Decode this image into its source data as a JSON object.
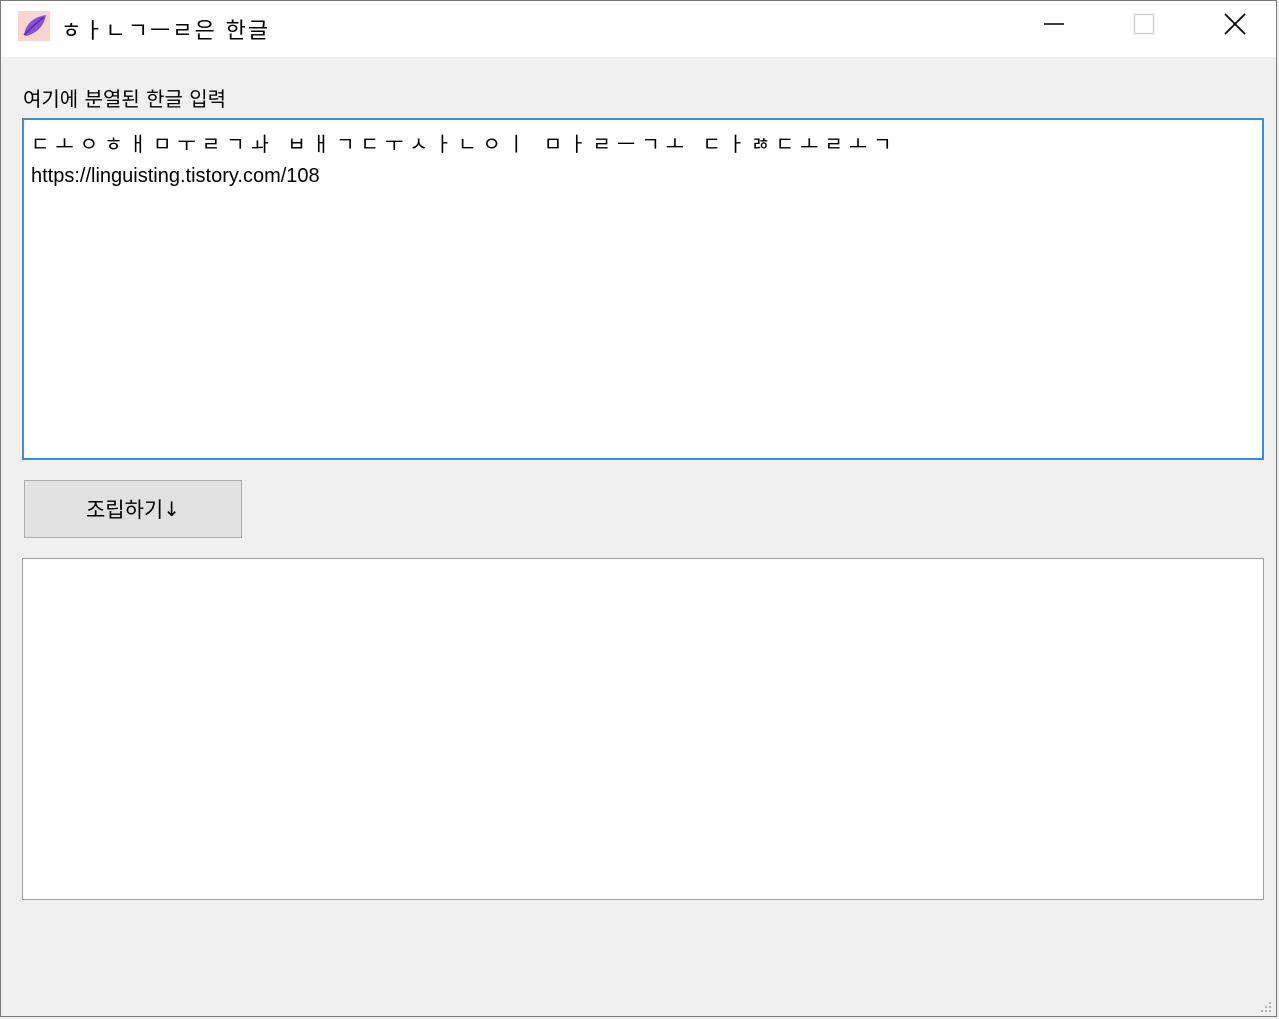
{
  "window": {
    "title": "ㅎㅏㄴㄱㅡㄹ은 한글"
  },
  "input_section": {
    "label": "여기에 분열된 한글 입력",
    "lines": [
      "ㄷㅗㅇㅎㅐㅁㅜㄹㄱㅘ ㅂㅐㄱㄷㅜㅅㅏㄴㅇㅣ ㅁㅏㄹㅡㄱㅗ ㄷㅏㅀㄷㅗㄹㅗㄱ",
      "https://linguisting.tistory.com/108"
    ]
  },
  "assemble_button": {
    "label": "조립하기",
    "arrow": "↓"
  },
  "output_section": {
    "value": ""
  },
  "icons": {
    "app": "leaf-app-icon",
    "minimize": "minimize-icon",
    "maximize": "maximize-icon",
    "close": "close-icon",
    "grip": "resize-grip-icon"
  }
}
